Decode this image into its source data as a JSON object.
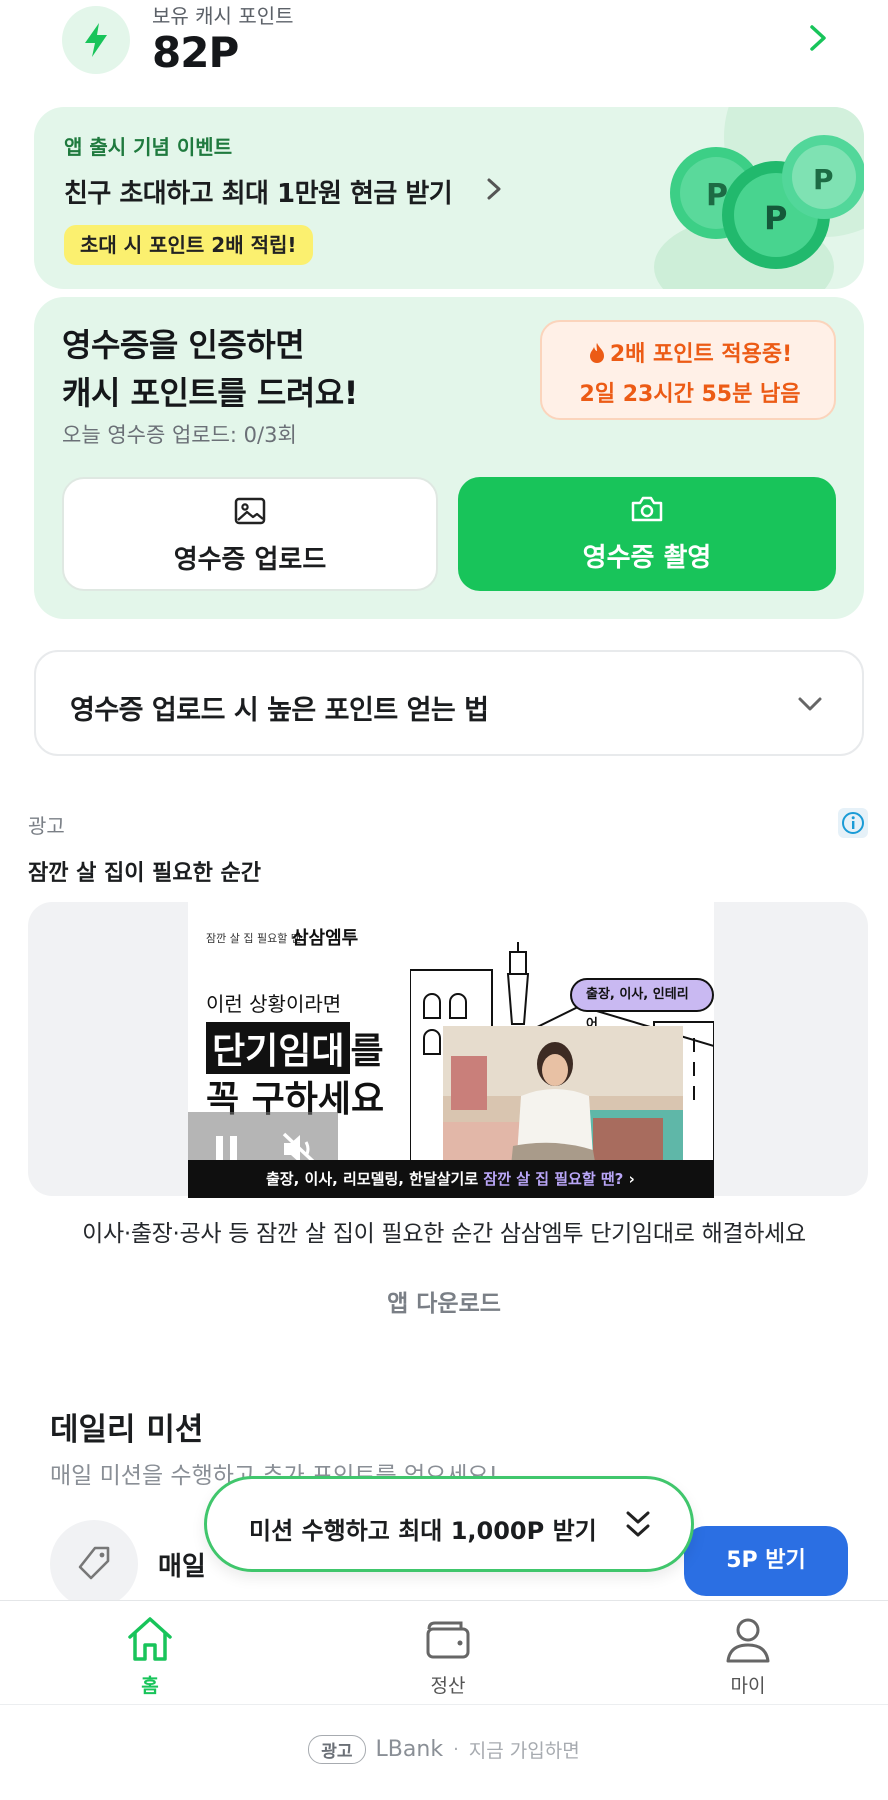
{
  "points": {
    "label": "보유 캐시 포인트",
    "value": "82P"
  },
  "event": {
    "kicker": "앱 출시 기념 이벤트",
    "title": "친구 초대하고 최대 1만원 현금 받기",
    "badge": "초대 시 포인트 2배 적립!",
    "coin_letter": "P"
  },
  "receipt": {
    "title_line1": "영수증을 인증하면",
    "title_line2": "캐시 포인트를 드려요!",
    "count": "오늘 영수증 업로드: 0/3회",
    "promo_line1": "2배 포인트 적용중!",
    "promo_line2": "2일 23시간 55분 남음",
    "upload_label": "영수증 업로드",
    "shoot_label": "영수증 촬영"
  },
  "tips": {
    "title": "영수증 업로드 시 높은 포인트 얻는 법"
  },
  "ad": {
    "label": "광고",
    "headline": "잠깐 살 집이 필요한 순간",
    "video": {
      "brand_small": "잠깐 살 집 필요할 땐",
      "brand": "삼삼엠투",
      "intro": "이런 상황이라면",
      "hl1_box": "단기임대",
      "hl1_rest": "를",
      "hl2": "꼭 구하세요",
      "bubble": "출장, 이사, 인테리어",
      "bar_plain": "출장, 이사, 리모델링, 한달살기로 ",
      "bar_highlight": "잠깐 살 집 필요할 땐?",
      "bar_chevron": "›"
    },
    "description": "이사·출장·공사 등 잠깐 살 집이 필요한 순간 삼삼엠투 단기임대로 해결하세요",
    "cta": "앱 다운로드"
  },
  "daily_mission": {
    "title": "데일리 미션",
    "subtitle": "매일 미션을 수행하고 추가 포인트를 얻으세요!",
    "item_label": "매일",
    "item_button": "5P 받기",
    "pill_text": "미션 수행하고 최대 1,000P 받기"
  },
  "tabbar": {
    "home": "홈",
    "settle": "정산",
    "my": "마이",
    "active_color": "#18c45a"
  },
  "bottom_ad": {
    "badge": "광고",
    "brand": "LBank",
    "separator": "·",
    "text": "지금 가입하면"
  },
  "colors": {
    "brand_green": "#18c45a",
    "mint_bg": "#e3f6ea",
    "promo_orange": "#ec5b15",
    "blue_button": "#2b6fe3"
  }
}
